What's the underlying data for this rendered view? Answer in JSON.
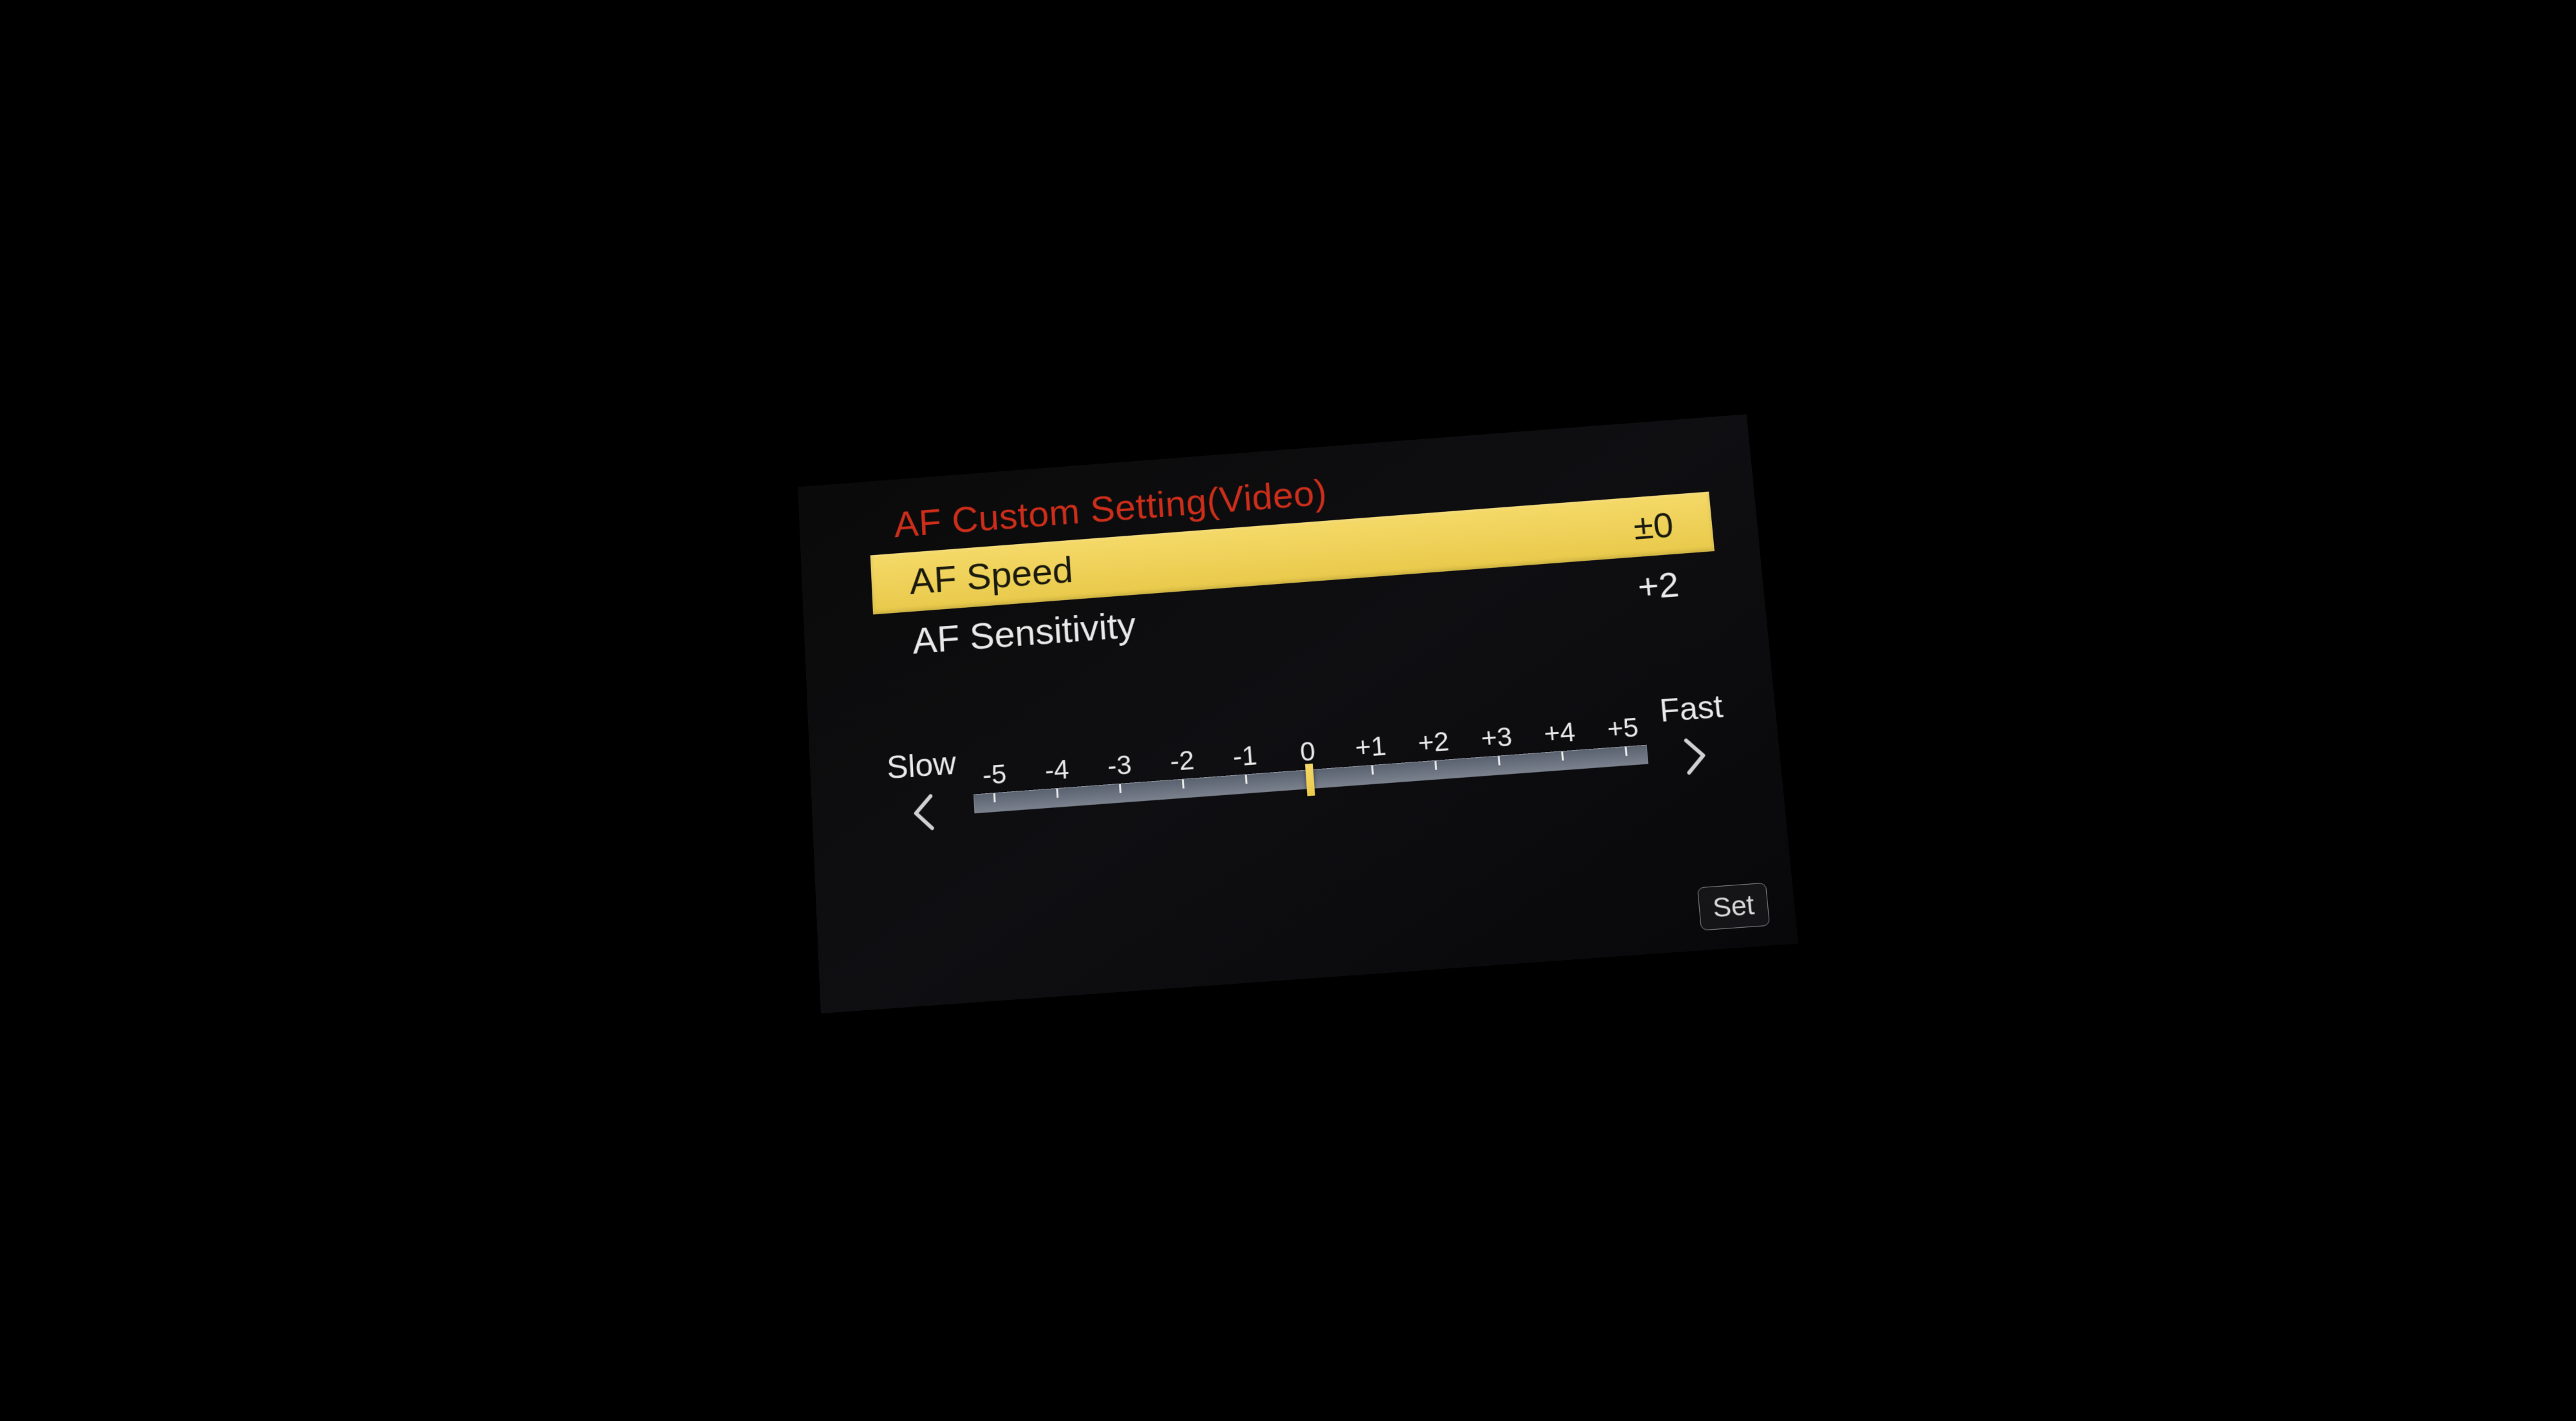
{
  "title": "AF Custom Setting(Video)",
  "menu": [
    {
      "label": "AF Speed",
      "value": "±0",
      "selected": true
    },
    {
      "label": "AF Sensitivity",
      "value": "+2",
      "selected": false
    }
  ],
  "slider": {
    "left_label": "Slow",
    "right_label": "Fast",
    "ticks": [
      "-5",
      "-4",
      "-3",
      "-2",
      "-1",
      "0",
      "+1",
      "+2",
      "+3",
      "+4",
      "+5"
    ],
    "current_index": 5
  },
  "set_button": "Set"
}
